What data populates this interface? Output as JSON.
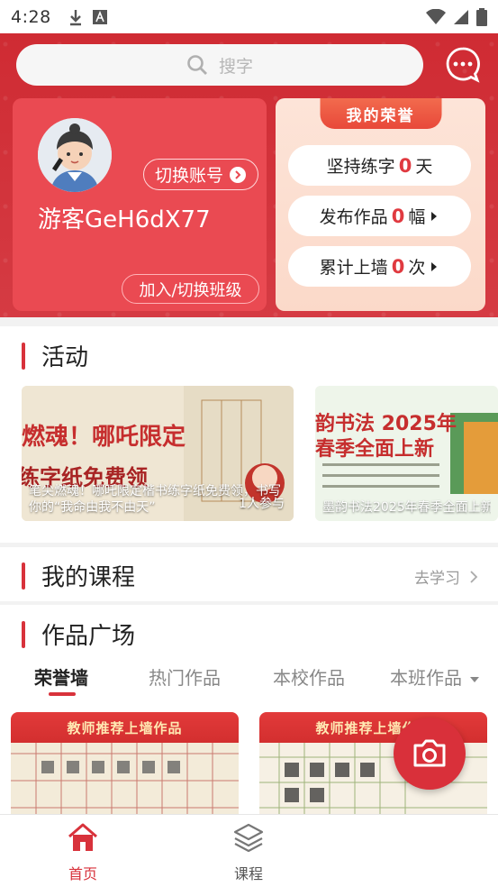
{
  "status_bar": {
    "time": "4:28"
  },
  "search": {
    "placeholder": "搜字"
  },
  "profile": {
    "username": "游客GeH6dX77",
    "switch_account": "切换账号",
    "join_class": "加入/切换班级"
  },
  "honor": {
    "title": "我的荣誉",
    "rows": [
      {
        "label": "坚持练字",
        "value": "0",
        "unit": "天"
      },
      {
        "label": "发布作品",
        "value": "0",
        "unit": "幅"
      },
      {
        "label": "累计上墙",
        "value": "0",
        "unit": "次"
      }
    ]
  },
  "activity": {
    "title": "活动",
    "cards": [
      {
        "banner_text_1": "燃魂！哪吒限定",
        "banner_text_2": "练字纸免费领",
        "caption": "笔尖燃魂！哪吒限定楷书练字纸免费领，书写你的“我命由我不由天”",
        "participants": "1人参与"
      },
      {
        "banner_text_1": "韵书法 2025年",
        "banner_text_2": "春季全面上新",
        "caption": "墨韵书法2025年春季全面上新"
      }
    ]
  },
  "courses": {
    "title": "我的课程",
    "action": "去学习"
  },
  "works": {
    "title": "作品广场",
    "tabs": [
      "荣誉墙",
      "热门作品",
      "本校作品",
      "本班作品"
    ],
    "cards": [
      {
        "banner": "教师推荐上墙作品"
      },
      {
        "banner": "教师推荐上墙作品"
      }
    ]
  },
  "bottom_nav": {
    "items": [
      "首页",
      "课程"
    ]
  },
  "colors": {
    "primary_red": "#d8323b",
    "honor_bg": "#fde4d8"
  }
}
